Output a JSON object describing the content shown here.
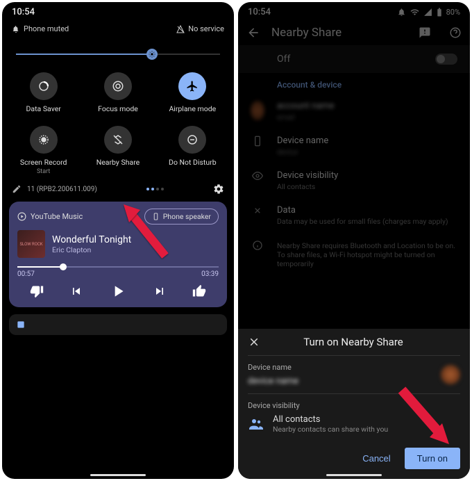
{
  "status": {
    "time": "10:54",
    "battery": "80%"
  },
  "left": {
    "muted_label": "Phone muted",
    "no_service_label": "No service",
    "tiles": [
      {
        "label": "Data Saver",
        "sub": ""
      },
      {
        "label": "Focus mode",
        "sub": ""
      },
      {
        "label": "Airplane mode",
        "sub": ""
      },
      {
        "label": "Screen Record",
        "sub": "Start"
      },
      {
        "label": "Nearby Share",
        "sub": ""
      },
      {
        "label": "Do Not Disturb",
        "sub": ""
      }
    ],
    "build": "11 (RPB2.200611.009)",
    "media": {
      "app": "YouTube Music",
      "output": "Phone speaker",
      "album_tag": "SLOW ROCK",
      "title": "Wonderful Tonight",
      "artist": "Eric Clapton",
      "elapsed": "00:57",
      "total": "03:39"
    }
  },
  "right": {
    "page_title": "Nearby Share",
    "toggle_state": "Off",
    "section_header": "Account & device",
    "rows": {
      "device_name": {
        "title": "Device name",
        "sub": ""
      },
      "visibility": {
        "title": "Device visibility",
        "sub": "All contacts"
      },
      "data": {
        "title": "Data",
        "sub": "Data may be used for small files (charges may apply)"
      },
      "info": {
        "sub": "Nearby Share requires Bluetooth and Location to be on. To share files, a Wi-Fi hotspot might be turned on temporarily"
      }
    },
    "sheet": {
      "title": "Turn on Nearby Share",
      "device_name_label": "Device name",
      "device_name_value": "",
      "visibility_label": "Device visibility",
      "visibility_value": "All contacts",
      "visibility_sub": "Nearby contacts can share with you",
      "cancel": "Cancel",
      "turn_on": "Turn on"
    }
  }
}
